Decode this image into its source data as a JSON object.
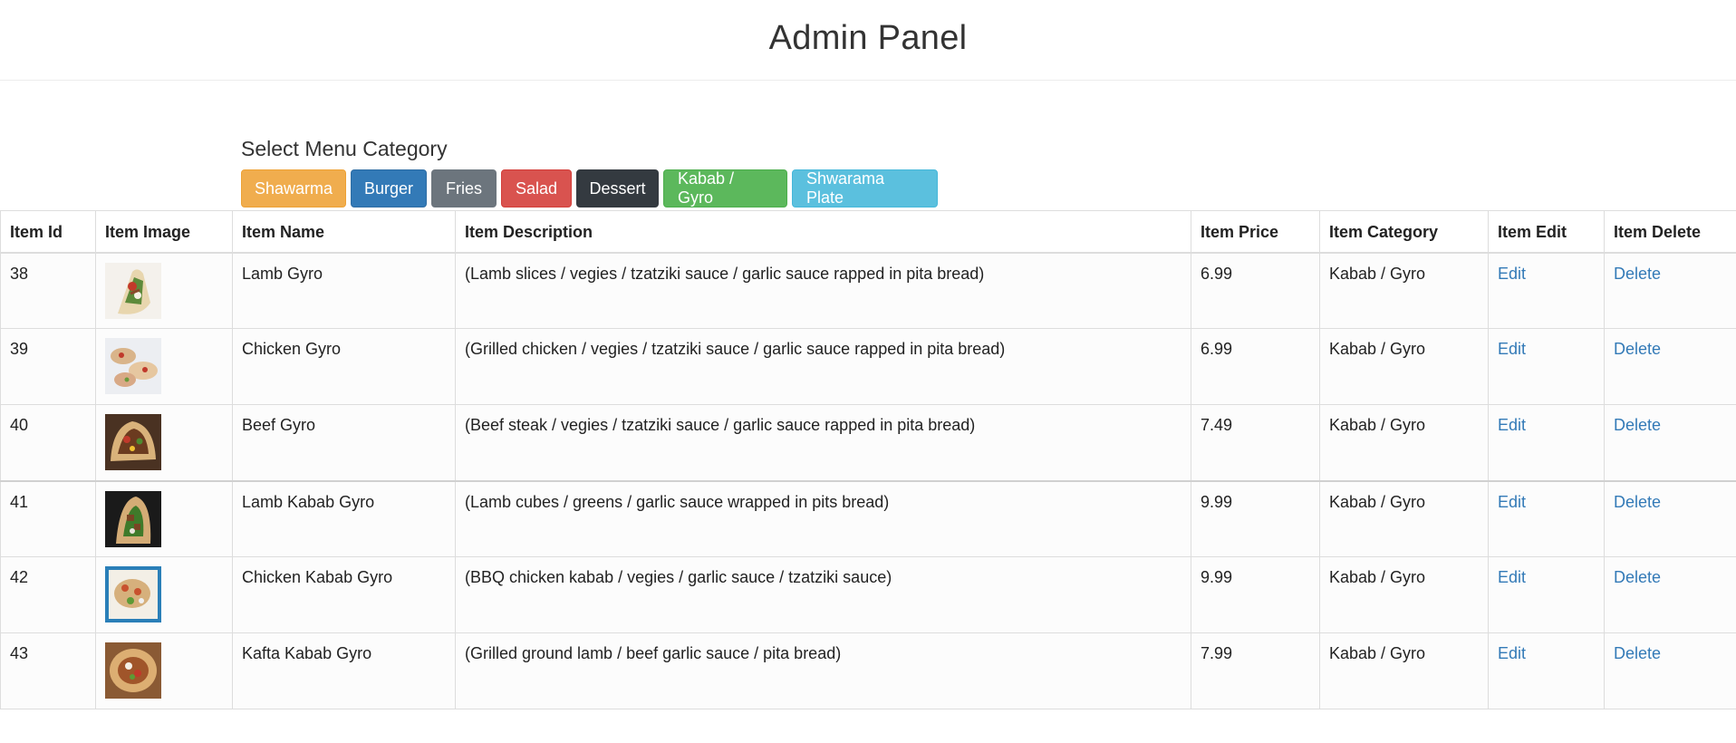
{
  "header": {
    "title": "Admin Panel"
  },
  "category": {
    "title": "Select Menu Category",
    "buttons": [
      {
        "label": "Shawarma",
        "color": "#f0ad4e"
      },
      {
        "label": "Burger",
        "color": "#337ab7"
      },
      {
        "label": "Fries",
        "color": "#6c757d"
      },
      {
        "label": "Salad",
        "color": "#d9534f"
      },
      {
        "label": "Dessert",
        "color": "#343a40"
      },
      {
        "label": "Kabab / Gyro",
        "color": "#5cb85c"
      },
      {
        "label": "Shwarama Plate",
        "color": "#5bc0de"
      }
    ]
  },
  "table": {
    "headers": [
      "Item Id",
      "Item Image",
      "Item Name",
      "Item Description",
      "Item Price",
      "Item Category",
      "Item Edit",
      "Item Delete"
    ],
    "rows": [
      {
        "id": "38",
        "image": "lamb-gyro-photo",
        "name": "Lamb Gyro",
        "description": "(Lamb slices / vegies / tzatziki sauce / garlic sauce rapped in pita bread)",
        "price": "6.99",
        "category": "Kabab / Gyro",
        "edit": "Edit",
        "delete": "Delete"
      },
      {
        "id": "39",
        "image": "chicken-gyro-photo",
        "name": "Chicken Gyro",
        "description": "(Grilled chicken / vegies / tzatziki sauce / garlic sauce rapped in pita bread)",
        "price": "6.99",
        "category": "Kabab / Gyro",
        "edit": "Edit",
        "delete": "Delete"
      },
      {
        "id": "40",
        "image": "beef-gyro-photo",
        "name": "Beef Gyro",
        "description": "(Beef steak / vegies / tzatziki sauce / garlic sauce rapped in pita bread)",
        "price": "7.49",
        "category": "Kabab / Gyro",
        "edit": "Edit",
        "delete": "Delete"
      },
      {
        "id": "41",
        "image": "lamb-kabab-gyro-photo",
        "name": "Lamb Kabab Gyro",
        "description": "(Lamb cubes / greens / garlic sauce wrapped in pits bread)",
        "price": "9.99",
        "category": "Kabab / Gyro",
        "edit": "Edit",
        "delete": "Delete"
      },
      {
        "id": "42",
        "image": "chicken-kabab-gyro-photo",
        "name": "Chicken Kabab Gyro",
        "description": "(BBQ chicken kabab / vegies / garlic sauce / tzatziki sauce)",
        "price": "9.99",
        "category": "Kabab / Gyro",
        "edit": "Edit",
        "delete": "Delete"
      },
      {
        "id": "43",
        "image": "kafta-kabab-gyro-photo",
        "name": "Kafta Kabab Gyro",
        "description": "(Grilled ground lamb / beef garlic sauce / pita bread)",
        "price": "7.99",
        "category": "Kabab / Gyro",
        "edit": "Edit",
        "delete": "Delete"
      }
    ]
  },
  "colors": {
    "link": "#337ab7",
    "border": "#dddddd"
  }
}
